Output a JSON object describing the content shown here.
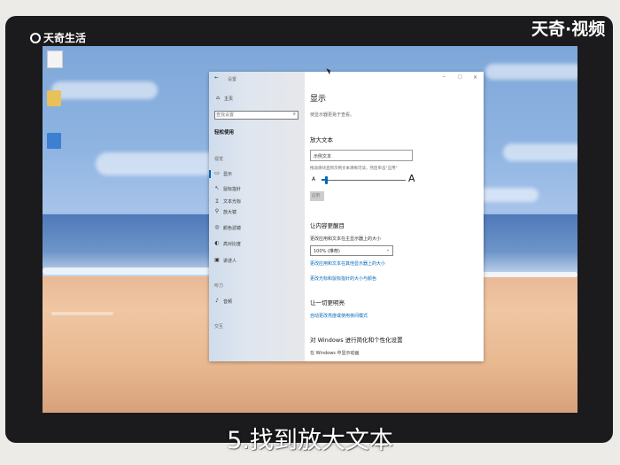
{
  "branding": {
    "left_logo_text": "天奇生活",
    "right_logo_text": "天奇·视频"
  },
  "caption": "5.找到放大文本",
  "settings_window": {
    "title": "设置",
    "title_controls": {
      "minimize": "−",
      "maximize": "□",
      "close": "×"
    },
    "sidebar": {
      "back_icon": "back-arrow-icon",
      "home_label": "主页",
      "search_placeholder": "查找设置",
      "category_title": "轻松使用",
      "section_vision": "视觉",
      "items_vision": [
        {
          "icon": "display-icon",
          "label": "显示"
        },
        {
          "icon": "mouse-pointer-icon",
          "label": "鼠标指针"
        },
        {
          "icon": "text-cursor-icon",
          "label": "文本光标"
        },
        {
          "icon": "magnifier-icon",
          "label": "放大镜"
        },
        {
          "icon": "color-filter-icon",
          "label": "颜色滤镜"
        },
        {
          "icon": "high-contrast-icon",
          "label": "高对比度"
        },
        {
          "icon": "narrator-icon",
          "label": "讲述人"
        }
      ],
      "section_hearing": "听力",
      "items_hearing": [
        {
          "icon": "audio-icon",
          "label": "音频"
        }
      ],
      "section_interaction": "交互"
    },
    "main": {
      "page_title": "显示",
      "page_subtitle": "使显示器更易于查看。",
      "enlarge_text": {
        "heading": "放大文本",
        "sample_text": "示例文本",
        "slider_instruction": "拖动滑块直到示例文本清晰可读，然后单击\"应用\"",
        "small_a": "A",
        "large_a": "A",
        "slider_level_percent": 5,
        "apply_label": "应用"
      },
      "make_bigger": {
        "heading": "让内容更醒目",
        "scale_label": "更改应用和文本在主显示器上的大小",
        "scale_value": "100% (推荐)",
        "link_other_display": "更改应用和文本在其他显示器上的大小",
        "link_pointer_size": "更改光标和鼠标指针的大小与颜色"
      },
      "brighter": {
        "heading": "让一切更明亮",
        "link_night_light": "自动更改亮度或使用夜间模式"
      },
      "simplify": {
        "heading": "对 Windows 进行简化和个性化设置",
        "show_animations": "在 Windows 中显示动画"
      }
    }
  }
}
